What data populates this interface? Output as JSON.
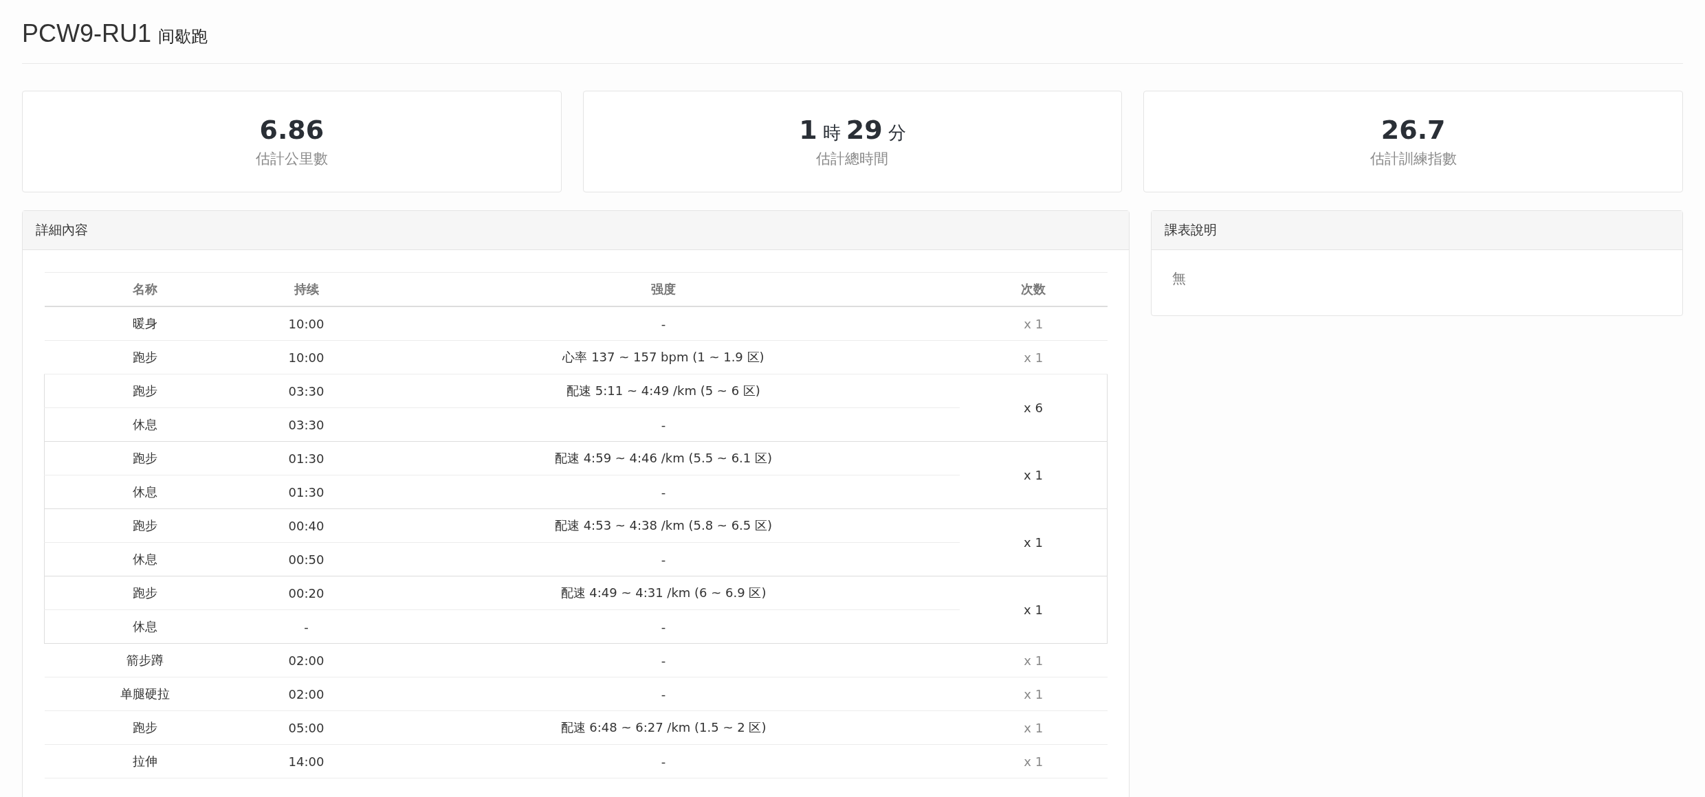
{
  "title": {
    "code": "PCW9-RU1",
    "name": "间歇跑"
  },
  "stats": [
    {
      "parts": [
        {
          "kind": "number",
          "text": "6.86"
        }
      ],
      "label": "估計公里數"
    },
    {
      "parts": [
        {
          "kind": "number",
          "text": "1"
        },
        {
          "kind": "unit",
          "text": "時"
        },
        {
          "kind": "number",
          "text": "29"
        },
        {
          "kind": "unit",
          "text": "分"
        }
      ],
      "label": "估計總時間"
    },
    {
      "parts": [
        {
          "kind": "number",
          "text": "26.7"
        }
      ],
      "label": "估計訓練指數"
    }
  ],
  "details": {
    "heading": "詳細內容",
    "columns": [
      "名称",
      "持续",
      "强度",
      "次数"
    ],
    "rows": [
      {
        "kind": "single",
        "name": "暖身",
        "duration": "10:00",
        "intensity": "-",
        "count": "x 1"
      },
      {
        "kind": "single",
        "name": "跑步",
        "duration": "10:00",
        "intensity": "心率 137 ~ 157 bpm (1 ~ 1.9 区)",
        "count": "x 1"
      },
      {
        "kind": "group",
        "count": "x 6",
        "steps": [
          {
            "name": "跑步",
            "duration": "03:30",
            "intensity": "配速 5:11 ~ 4:49 /km (5 ~ 6 区)"
          },
          {
            "name": "休息",
            "duration": "03:30",
            "intensity": "-"
          }
        ]
      },
      {
        "kind": "group",
        "count": "x 1",
        "steps": [
          {
            "name": "跑步",
            "duration": "01:30",
            "intensity": "配速 4:59 ~ 4:46 /km (5.5 ~ 6.1 区)"
          },
          {
            "name": "休息",
            "duration": "01:30",
            "intensity": "-"
          }
        ]
      },
      {
        "kind": "group",
        "count": "x 1",
        "steps": [
          {
            "name": "跑步",
            "duration": "00:40",
            "intensity": "配速 4:53 ~ 4:38 /km (5.8 ~ 6.5 区)"
          },
          {
            "name": "休息",
            "duration": "00:50",
            "intensity": "-"
          }
        ]
      },
      {
        "kind": "group",
        "count": "x 1",
        "steps": [
          {
            "name": "跑步",
            "duration": "00:20",
            "intensity": "配速 4:49 ~ 4:31 /km (6 ~ 6.9 区)"
          },
          {
            "name": "休息",
            "duration": "-",
            "intensity": "-"
          }
        ]
      },
      {
        "kind": "single",
        "name": "箭步蹲",
        "duration": "02:00",
        "intensity": "-",
        "count": "x 1"
      },
      {
        "kind": "single",
        "name": "单腿硬拉",
        "duration": "02:00",
        "intensity": "-",
        "count": "x 1"
      },
      {
        "kind": "single",
        "name": "跑步",
        "duration": "05:00",
        "intensity": "配速 6:48 ~ 6:27 /km (1.5 ~ 2 区)",
        "count": "x 1"
      },
      {
        "kind": "single",
        "name": "拉伸",
        "duration": "14:00",
        "intensity": "-",
        "count": "x 1"
      }
    ]
  },
  "description": {
    "heading": "課表說明",
    "text": "無"
  }
}
